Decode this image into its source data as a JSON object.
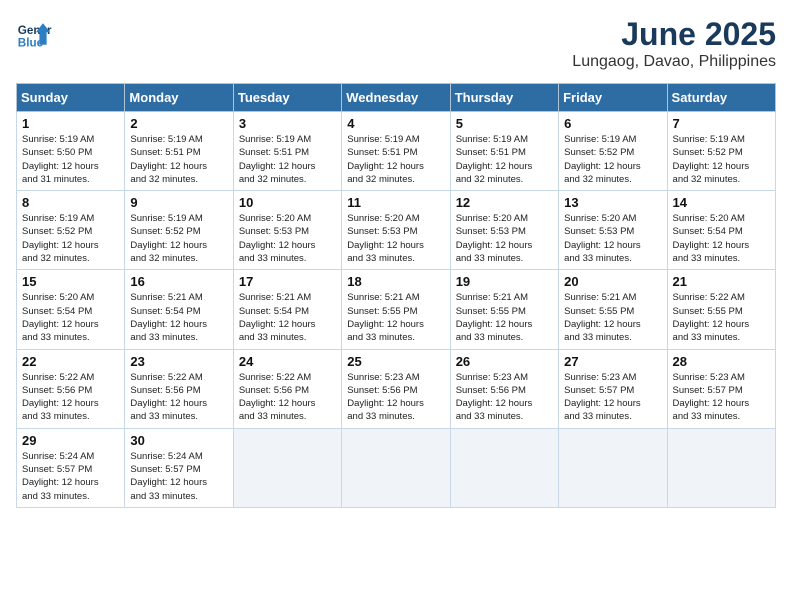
{
  "logo": {
    "line1": "General",
    "line2": "Blue"
  },
  "title": "June 2025",
  "subtitle": "Lungaog, Davao, Philippines",
  "headers": [
    "Sunday",
    "Monday",
    "Tuesday",
    "Wednesday",
    "Thursday",
    "Friday",
    "Saturday"
  ],
  "weeks": [
    [
      {
        "day": "1",
        "rise": "5:19 AM",
        "set": "5:50 PM",
        "hours": "12 hours",
        "mins": "31 minutes"
      },
      {
        "day": "2",
        "rise": "5:19 AM",
        "set": "5:51 PM",
        "hours": "12 hours",
        "mins": "32 minutes"
      },
      {
        "day": "3",
        "rise": "5:19 AM",
        "set": "5:51 PM",
        "hours": "12 hours",
        "mins": "32 minutes"
      },
      {
        "day": "4",
        "rise": "5:19 AM",
        "set": "5:51 PM",
        "hours": "12 hours",
        "mins": "32 minutes"
      },
      {
        "day": "5",
        "rise": "5:19 AM",
        "set": "5:51 PM",
        "hours": "12 hours",
        "mins": "32 minutes"
      },
      {
        "day": "6",
        "rise": "5:19 AM",
        "set": "5:52 PM",
        "hours": "12 hours",
        "mins": "32 minutes"
      },
      {
        "day": "7",
        "rise": "5:19 AM",
        "set": "5:52 PM",
        "hours": "12 hours",
        "mins": "32 minutes"
      }
    ],
    [
      {
        "day": "8",
        "rise": "5:19 AM",
        "set": "5:52 PM",
        "hours": "12 hours",
        "mins": "32 minutes"
      },
      {
        "day": "9",
        "rise": "5:19 AM",
        "set": "5:52 PM",
        "hours": "12 hours",
        "mins": "32 minutes"
      },
      {
        "day": "10",
        "rise": "5:20 AM",
        "set": "5:53 PM",
        "hours": "12 hours",
        "mins": "33 minutes"
      },
      {
        "day": "11",
        "rise": "5:20 AM",
        "set": "5:53 PM",
        "hours": "12 hours",
        "mins": "33 minutes"
      },
      {
        "day": "12",
        "rise": "5:20 AM",
        "set": "5:53 PM",
        "hours": "12 hours",
        "mins": "33 minutes"
      },
      {
        "day": "13",
        "rise": "5:20 AM",
        "set": "5:53 PM",
        "hours": "12 hours",
        "mins": "33 minutes"
      },
      {
        "day": "14",
        "rise": "5:20 AM",
        "set": "5:54 PM",
        "hours": "12 hours",
        "mins": "33 minutes"
      }
    ],
    [
      {
        "day": "15",
        "rise": "5:20 AM",
        "set": "5:54 PM",
        "hours": "12 hours",
        "mins": "33 minutes"
      },
      {
        "day": "16",
        "rise": "5:21 AM",
        "set": "5:54 PM",
        "hours": "12 hours",
        "mins": "33 minutes"
      },
      {
        "day": "17",
        "rise": "5:21 AM",
        "set": "5:54 PM",
        "hours": "12 hours",
        "mins": "33 minutes"
      },
      {
        "day": "18",
        "rise": "5:21 AM",
        "set": "5:55 PM",
        "hours": "12 hours",
        "mins": "33 minutes"
      },
      {
        "day": "19",
        "rise": "5:21 AM",
        "set": "5:55 PM",
        "hours": "12 hours",
        "mins": "33 minutes"
      },
      {
        "day": "20",
        "rise": "5:21 AM",
        "set": "5:55 PM",
        "hours": "12 hours",
        "mins": "33 minutes"
      },
      {
        "day": "21",
        "rise": "5:22 AM",
        "set": "5:55 PM",
        "hours": "12 hours",
        "mins": "33 minutes"
      }
    ],
    [
      {
        "day": "22",
        "rise": "5:22 AM",
        "set": "5:56 PM",
        "hours": "12 hours",
        "mins": "33 minutes"
      },
      {
        "day": "23",
        "rise": "5:22 AM",
        "set": "5:56 PM",
        "hours": "12 hours",
        "mins": "33 minutes"
      },
      {
        "day": "24",
        "rise": "5:22 AM",
        "set": "5:56 PM",
        "hours": "12 hours",
        "mins": "33 minutes"
      },
      {
        "day": "25",
        "rise": "5:23 AM",
        "set": "5:56 PM",
        "hours": "12 hours",
        "mins": "33 minutes"
      },
      {
        "day": "26",
        "rise": "5:23 AM",
        "set": "5:56 PM",
        "hours": "12 hours",
        "mins": "33 minutes"
      },
      {
        "day": "27",
        "rise": "5:23 AM",
        "set": "5:57 PM",
        "hours": "12 hours",
        "mins": "33 minutes"
      },
      {
        "day": "28",
        "rise": "5:23 AM",
        "set": "5:57 PM",
        "hours": "12 hours",
        "mins": "33 minutes"
      }
    ],
    [
      {
        "day": "29",
        "rise": "5:24 AM",
        "set": "5:57 PM",
        "hours": "12 hours",
        "mins": "33 minutes"
      },
      {
        "day": "30",
        "rise": "5:24 AM",
        "set": "5:57 PM",
        "hours": "12 hours",
        "mins": "33 minutes"
      },
      null,
      null,
      null,
      null,
      null
    ]
  ]
}
